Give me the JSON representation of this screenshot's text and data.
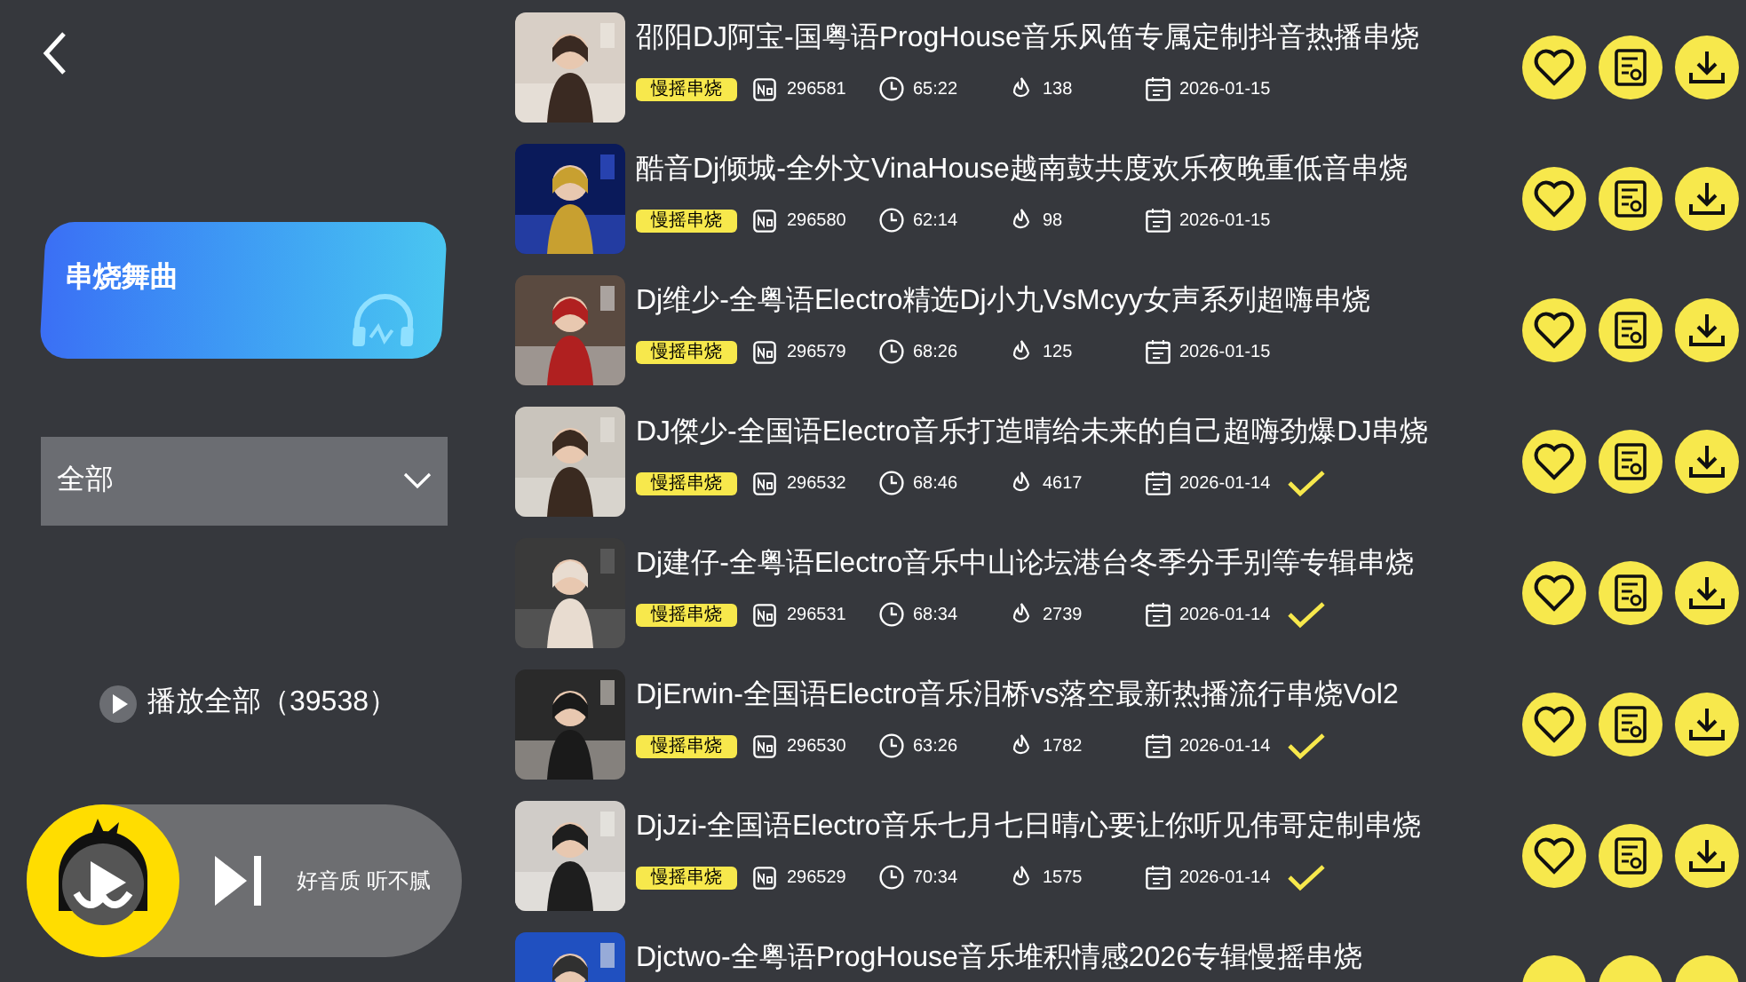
{
  "sidebar": {
    "category_card": {
      "title": "串烧舞曲"
    },
    "filter": {
      "value": "全部"
    },
    "play_all": {
      "label": "播放全部（39538）"
    },
    "player": {
      "slogan": "好音质 听不腻"
    }
  },
  "tracks": [
    {
      "title": "邵阳DJ阿宝-国粤语ProgHouse音乐风笛专属定制抖音热播串烧",
      "tag": "慢摇串烧",
      "no": "296581",
      "duration": "65:22",
      "plays": "138",
      "date": "2026-01-15",
      "downloaded": false
    },
    {
      "title": "酷音Dj倾城-全外文VinaHouse越南鼓共度欢乐夜晚重低音串烧",
      "tag": "慢摇串烧",
      "no": "296580",
      "duration": "62:14",
      "plays": "98",
      "date": "2026-01-15",
      "downloaded": false
    },
    {
      "title": "Dj维少-全粤语Electro精选Dj小九VsMcyy女声系列超嗨串烧",
      "tag": "慢摇串烧",
      "no": "296579",
      "duration": "68:26",
      "plays": "125",
      "date": "2026-01-15",
      "downloaded": false
    },
    {
      "title": "DJ傑少-全国语Electro音乐打造晴给未来的自己超嗨劲爆DJ串烧",
      "tag": "慢摇串烧",
      "no": "296532",
      "duration": "68:46",
      "plays": "4617",
      "date": "2026-01-14",
      "downloaded": true
    },
    {
      "title": "Dj建仔-全粤语Electro音乐中山论坛港台冬季分手别等专辑串烧",
      "tag": "慢摇串烧",
      "no": "296531",
      "duration": "68:34",
      "plays": "2739",
      "date": "2026-01-14",
      "downloaded": true
    },
    {
      "title": "DjErwin-全国语Electro音乐泪桥vs落空最新热播流行串烧Vol2",
      "tag": "慢摇串烧",
      "no": "296530",
      "duration": "63:26",
      "plays": "1782",
      "date": "2026-01-14",
      "downloaded": true
    },
    {
      "title": "DjJzi-全国语Electro音乐七月七日晴心要让你听见伟哥定制串烧",
      "tag": "慢摇串烧",
      "no": "296529",
      "duration": "70:34",
      "plays": "1575",
      "date": "2026-01-14",
      "downloaded": true
    },
    {
      "title": "Djctwo-全粤语ProgHouse音乐堆积情感2026专辑慢摇串烧"
    }
  ]
}
